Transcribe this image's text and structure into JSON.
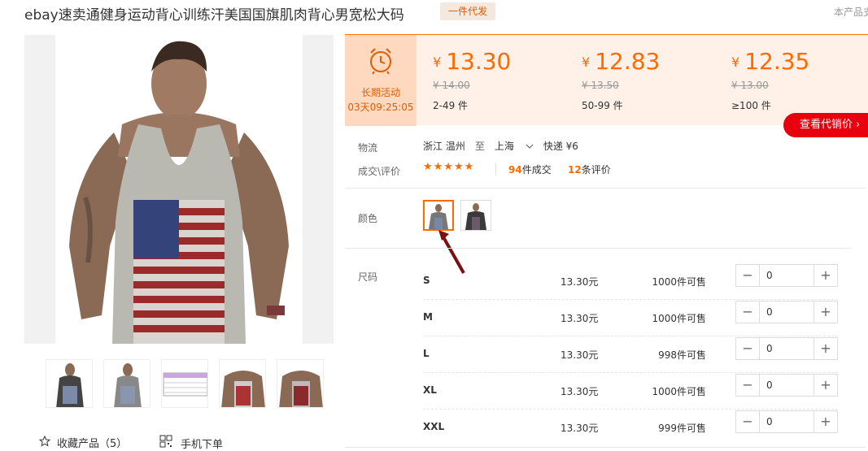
{
  "product": {
    "title": "ebay速卖通健身运动背心训练汗美国国旗肌肉背心男宽松大码",
    "tag": "一件代发",
    "corner_note": "本产品支"
  },
  "actions": {
    "favorite_label": "收藏产品（5）",
    "mobile_order_label": "手机下单"
  },
  "promo": {
    "label": "长期活动",
    "timer": "03天09:25:05"
  },
  "price_tiers": [
    {
      "currency": "¥",
      "price": "13.30",
      "original": "¥ 14.00",
      "range": "2-49 件"
    },
    {
      "currency": "¥",
      "price": "12.83",
      "original": "¥ 13.50",
      "range": "50-99 件"
    },
    {
      "currency": "¥",
      "price": "12.35",
      "original": "¥ 13.00",
      "range": "≥100 件"
    }
  ],
  "agent_button": "查看代销价 ›",
  "logistics": {
    "label": "物流",
    "from": "浙江 温州",
    "to_word": "至",
    "to": "上海",
    "shipping": "快递 ¥6"
  },
  "deals": {
    "label": "成交\\评价",
    "stars": "★★★★★",
    "deal_count": "94",
    "deal_suffix": "件成交",
    "review_count": "12",
    "review_suffix": "条评价"
  },
  "color": {
    "label": "颜色"
  },
  "size": {
    "label": "尺码",
    "rows": [
      {
        "name": "S",
        "price": "13.30元",
        "stock": "1000件可售",
        "qty": "0"
      },
      {
        "name": "M",
        "price": "13.30元",
        "stock": "1000件可售",
        "qty": "0"
      },
      {
        "name": "L",
        "price": "13.30元",
        "stock": "998件可售",
        "qty": "0"
      },
      {
        "name": "XL",
        "price": "13.30元",
        "stock": "1000件可售",
        "qty": "0"
      },
      {
        "name": "XXL",
        "price": "13.30元",
        "stock": "999件可售",
        "qty": "0"
      }
    ]
  },
  "colors": {
    "accent": "#ff6a00",
    "agent_red": "#e8000e",
    "price_panel_bg": "#fff1e7"
  }
}
